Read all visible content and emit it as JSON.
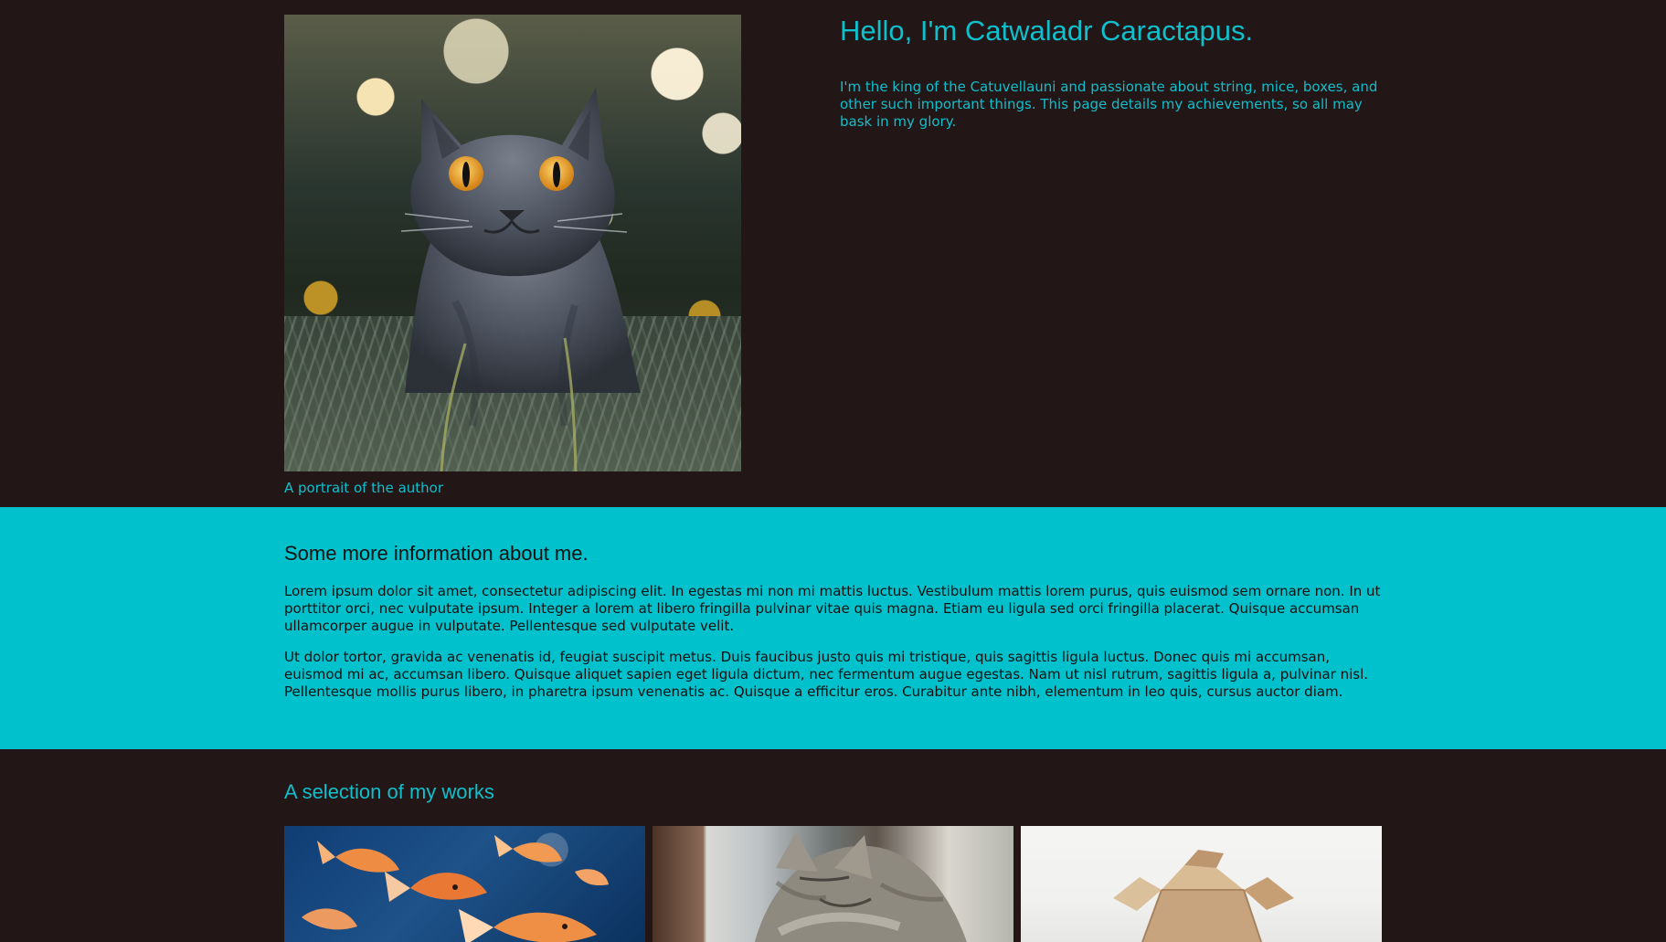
{
  "profile": {
    "heading": "Hello, I'm Catwaladr Caractapus.",
    "intro": "I'm the king of the Catuvellauni and passionate about string, mice, boxes, and other such important things. This page details my achievements, so all may bask in my glory.",
    "portrait_caption": "A portrait of the author"
  },
  "about": {
    "heading": "Some more information about me.",
    "paragraphs": [
      "Lorem ipsum dolor sit amet, consectetur adipiscing elit. In egestas mi non mi mattis luctus. Vestibulum mattis lorem purus, quis euismod sem ornare non. In ut porttitor orci, nec vulputate ipsum. Integer a lorem at libero fringilla pulvinar vitae quis magna. Etiam eu ligula sed orci fringilla placerat. Quisque accumsan ullamcorper augue in vulputate. Pellentesque sed vulputate velit.",
      "Ut dolor tortor, gravida ac venenatis id, feugiat suscipit metus. Duis faucibus justo quis mi tristique, quis sagittis ligula luctus. Donec quis mi accumsan, euismod mi ac, accumsan libero. Quisque aliquet sapien eget ligula dictum, nec fermentum augue egestas. Nam ut nisl rutrum, sagittis ligula a, pulvinar nisl. Pellentesque mollis purus libero, in pharetra ipsum venenatis ac. Quisque a efficitur eros. Curabitur ante nibh, elementum in leo quis, cursus auctor diam."
    ]
  },
  "works": {
    "heading": "A selection of my works",
    "items": [
      {
        "image": "goldfish-image"
      },
      {
        "image": "sleeping-cat-image"
      },
      {
        "image": "cardboard-box-image"
      }
    ]
  },
  "colors": {
    "background": "#221616",
    "accent": "#10bfcc",
    "about_background": "#00c1cc",
    "about_text": "#111111"
  }
}
